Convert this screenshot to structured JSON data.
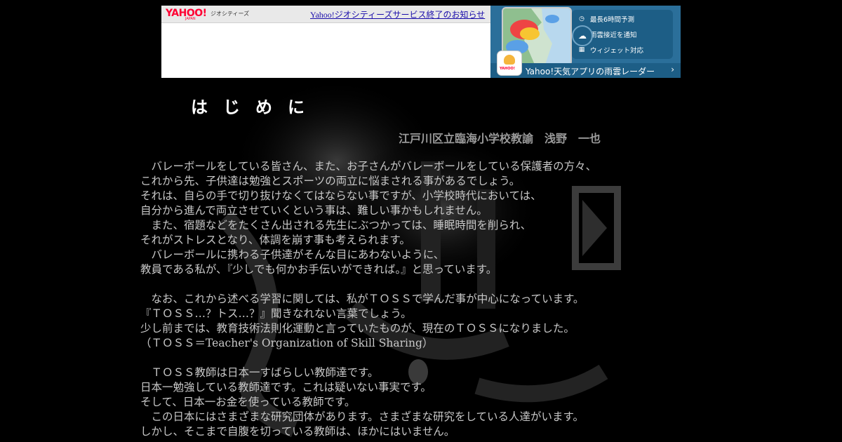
{
  "banner": {
    "logo": "YAHOO!",
    "logo_sub": "JAPAN",
    "service_label": "ジオシティーズ",
    "notice_link": "Yahoo!ジオシティーズサービス終了のお知らせ",
    "ad": {
      "features": [
        {
          "icon": "clock-icon",
          "label": "最長6時間予測"
        },
        {
          "icon": "location-pin-icon",
          "label": "雨雲接近を通知"
        },
        {
          "icon": "widget-icon",
          "label": "ウィジェット対応"
        }
      ],
      "app_icon_text": "YAHOO!",
      "cta": "Yahoo!天気アプリの雨雲レーダー",
      "chevron": "›"
    }
  },
  "page": {
    "title": "はじめに",
    "author": "江戸川区立臨海小学校教諭　浅野　一也",
    "lines": [
      "　バレーボールをしている皆さん、また、お子さんがバレーボールをしている保護者の方々、",
      "これから先、子供達は勉強とスポーツの両立に悩まされる事があるでしょう。",
      "それは、自らの手で切り抜けなくてはならない事ですが、小学校時代においては、",
      "自分から進んで両立させていくという事は、難しい事かもしれません。",
      "　また、宿題などをたくさん出される先生にぶつかっては、睡眠時間を削られ、",
      "それがストレスとなり、体調を崩す事も考えられます。",
      "　バレーボールに携わる子供達がそんな目にあわないように、",
      "教員である私が、『少しでも何かお手伝いができれば。』と思っています。",
      "",
      "　なお、これから述べる学習に関しては、私がＴＯＳＳで学んだ事が中心になっています。",
      "『ＴＯＳＳ…？トス…？』聞きなれない言葉でしょう。",
      "少し前までは、教育技術法則化運動と言っていたものが、現在のＴＯＳＳになりました。",
      "（ＴＯＳＳ＝Teacher's Organization of Skill Sharing）",
      "",
      "　ＴＯＳＳ教師は日本一すばらしい教師達です。",
      "日本一勉強している教師達です。これは疑いない事実です。",
      "そして、日本一お金を使っている教師です。",
      "　この日本にはさまざまな研究団体があります。さまざまな研究をしている人達がいます。",
      "しかし、そこまで自腹を切っている教師は、ほかにはいません。"
    ]
  }
}
